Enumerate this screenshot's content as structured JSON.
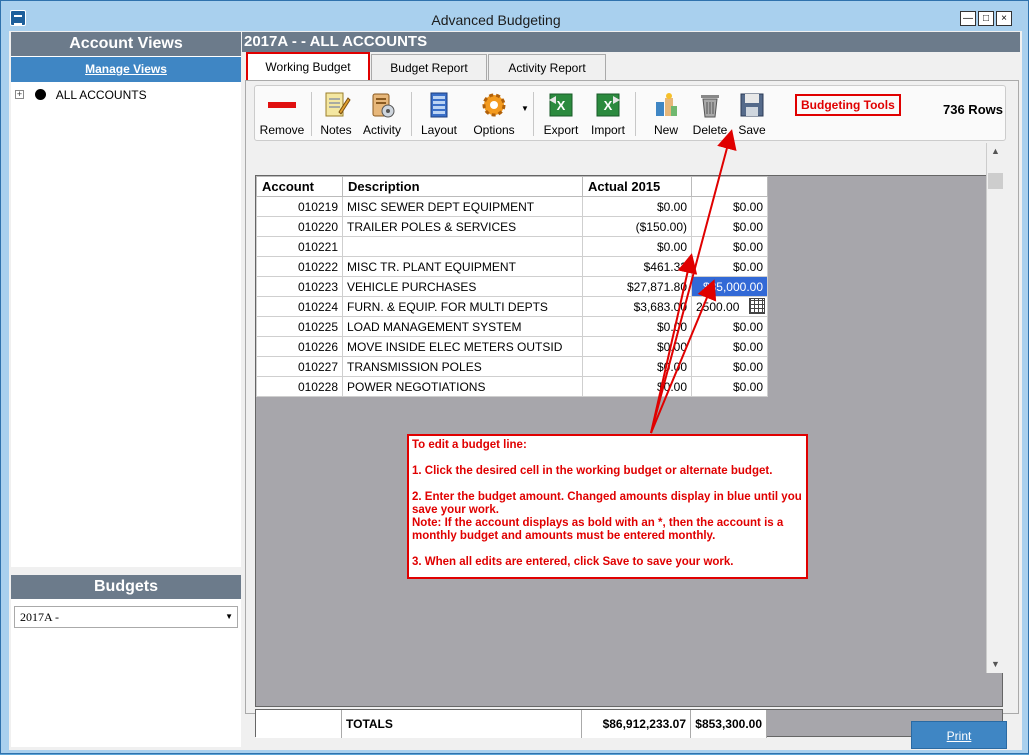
{
  "window": {
    "title": "Advanced Budgeting",
    "minimize": "—",
    "maximize": "□",
    "close": "×"
  },
  "left": {
    "account_views_header": "Account Views",
    "manage_views": "Manage Views",
    "tree": [
      {
        "label": "ALL ACCOUNTS",
        "expander": "+"
      }
    ],
    "budgets_header": "Budgets",
    "budget_selected": "2017A -"
  },
  "main": {
    "header": "2017A -  - ALL ACCOUNTS",
    "tabs": [
      {
        "label": "Working Budget",
        "active": true
      },
      {
        "label": "Budget Report",
        "active": false
      },
      {
        "label": "Activity Report",
        "active": false
      }
    ],
    "toolbar": {
      "tools": [
        {
          "label": "Remove",
          "icon": "remove-icon"
        },
        {
          "label": "Notes",
          "icon": "notes-icon"
        },
        {
          "label": "Activity",
          "icon": "activity-icon"
        },
        {
          "label": "Layout",
          "icon": "layout-icon"
        },
        {
          "label": "Options",
          "icon": "options-gear-icon"
        },
        {
          "label": "Export",
          "icon": "excel-export-icon"
        },
        {
          "label": "Import",
          "icon": "excel-import-icon"
        },
        {
          "label": "New",
          "icon": "new-icon"
        },
        {
          "label": "Delete",
          "icon": "trash-icon"
        },
        {
          "label": "Save",
          "icon": "floppy-disk-icon"
        }
      ],
      "budgeting_tools": "Budgeting Tools",
      "rows": "736 Rows"
    },
    "grid": {
      "columns": [
        "Account",
        "Description",
        "Actual 2015",
        ""
      ],
      "rows": [
        {
          "account": "010219",
          "description": "MISC SEWER DEPT EQUIPMENT",
          "actual": "$0.00",
          "budget": "$0.00"
        },
        {
          "account": "010220",
          "description": "TRAILER POLES & SERVICES",
          "actual": "($150.00)",
          "budget": "$0.00"
        },
        {
          "account": "010221",
          "description": "",
          "actual": "$0.00",
          "budget": "$0.00"
        },
        {
          "account": "010222",
          "description": "MISC TR. PLANT EQUIPMENT",
          "actual": "$461.33",
          "budget": "$0.00"
        },
        {
          "account": "010223",
          "description": "VEHICLE PURCHASES",
          "actual": "$27,871.80",
          "budget": "$35,000.00",
          "state": "selected"
        },
        {
          "account": "010224",
          "description": "FURN. & EQUIP. FOR MULTI DEPTS",
          "actual": "$3,683.00",
          "budget": "2500.00",
          "state": "editing"
        },
        {
          "account": "010225",
          "description": "LOAD MANAGEMENT SYSTEM",
          "actual": "$0.00",
          "budget": "$0.00"
        },
        {
          "account": "010226",
          "description": "MOVE INSIDE ELEC METERS OUTSID",
          "actual": "$0.00",
          "budget": "$0.00"
        },
        {
          "account": "010227",
          "description": "TRANSMISSION POLES",
          "actual": "$0.00",
          "budget": "$0.00"
        },
        {
          "account": "010228",
          "description": "POWER NEGOTIATIONS",
          "actual": "$0.00",
          "budget": "$0.00"
        }
      ],
      "totals_label": "TOTALS",
      "totals_actual": "$86,912,233.07",
      "totals_budget": "$853,300.00"
    },
    "print": "Print"
  },
  "callout": {
    "title": "To edit a budget line:",
    "step1": "1.  Click the desired cell in the working budget or alternate budget.",
    "step2": "2.  Enter the budget amount.  Changed amounts display in blue until you save your work.",
    "note": "Note: If the account displays as bold with an *, then the account is a monthly budget and amounts must be entered monthly.",
    "step3": "3.   When all edits are entered, click Save to save your work."
  },
  "colors": {
    "accent": "#3f86c4",
    "annotation": "#e00000",
    "selected_cell": "#3269d6",
    "header_bar": "#6c7b8b"
  }
}
